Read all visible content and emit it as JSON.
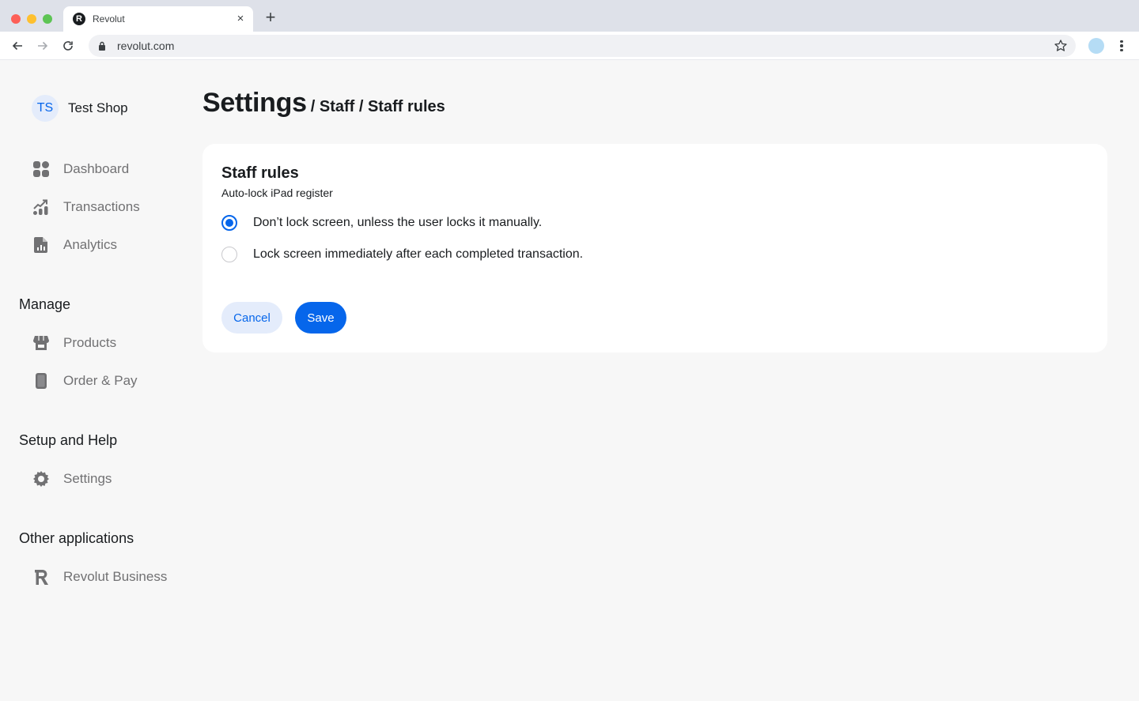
{
  "browser": {
    "tab_title": "Revolut",
    "favicon_letter": "R",
    "url": "revolut.com",
    "new_tab_symbol": "+",
    "close_tab_symbol": "×"
  },
  "sidebar": {
    "account": {
      "initials": "TS",
      "name": "Test Shop"
    },
    "main_items": [
      {
        "label": "Dashboard",
        "icon": "dashboard-icon"
      },
      {
        "label": "Transactions",
        "icon": "transactions-icon"
      },
      {
        "label": "Analytics",
        "icon": "analytics-icon"
      }
    ],
    "sections": [
      {
        "title": "Manage",
        "items": [
          {
            "label": "Products",
            "icon": "store-icon"
          },
          {
            "label": "Order & Pay",
            "icon": "tablet-icon"
          }
        ]
      },
      {
        "title": "Setup and Help",
        "items": [
          {
            "label": "Settings",
            "icon": "gear-icon"
          }
        ]
      },
      {
        "title": "Other applications",
        "items": [
          {
            "label": "Revolut Business",
            "icon": "revolut-logo-icon"
          }
        ]
      }
    ]
  },
  "header": {
    "title": "Settings",
    "breadcrumb_rest": "/ Staff / Staff rules"
  },
  "card": {
    "title": "Staff rules",
    "subtitle": "Auto-lock iPad register",
    "options": [
      {
        "label": "Don’t lock screen, unless the user locks it manually.",
        "selected": true
      },
      {
        "label": "Lock screen immediately after each completed transaction.",
        "selected": false
      }
    ],
    "cancel_label": "Cancel",
    "save_label": "Save"
  },
  "colors": {
    "accent": "#0666eb",
    "accent_light": "#e4ecfb",
    "background": "#f7f7f7",
    "text": "#191c1f",
    "muted": "#717173"
  }
}
